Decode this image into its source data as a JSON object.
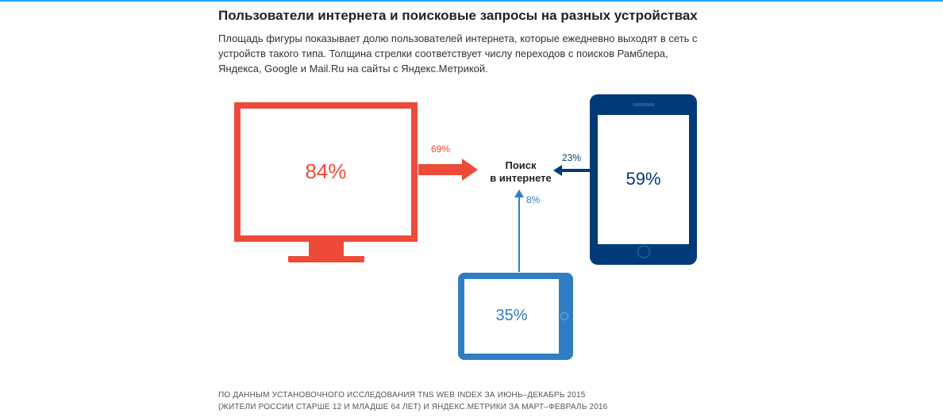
{
  "title": "Пользователи интернета и поисковые запросы на разных устройствах",
  "description": "Площадь фигуры показывает долю пользователей интернета, которые ежедневно выходят в сеть с устройств такого типа. Толщина стрелки соответствует числу переходов с поисков Рамблера, Яндекса, Google и Mail.Ru на сайты с Яндекс.Метрикой.",
  "center": {
    "line1": "Поиск",
    "line2": "в интернете"
  },
  "devices": {
    "desktop": {
      "share": "84%",
      "arrow": "69%",
      "color": "#ee4a3a"
    },
    "phone": {
      "share": "59%",
      "arrow": "23%",
      "color": "#003a77"
    },
    "tablet": {
      "share": "35%",
      "arrow": "8%",
      "color": "#2f7ec3"
    }
  },
  "footnote": {
    "line1": "ПО ДАННЫМ УСТАНОВОЧНОГО ИССЛЕДОВАНИЯ TNS WEB INDEX ЗА ИЮНЬ–ДЕКАБРЬ 2015",
    "line2": "(ЖИТЕЛИ РОССИИ СТАРШЕ 12 И МЛАДШЕ 64 ЛЕТ) И ЯНДЕКС.МЕТРИКИ ЗА МАРТ–ФЕВРАЛЬ 2016"
  },
  "chart_data": {
    "type": "diagram",
    "title": "Пользователи интернета и поисковые запросы на разных устройствах",
    "center_node": "Поиск в интернете",
    "nodes": [
      {
        "device": "desktop",
        "daily_users_share_pct": 84,
        "search_traffic_share_pct": 69,
        "color": "#ee4a3a"
      },
      {
        "device": "smartphone",
        "daily_users_share_pct": 59,
        "search_traffic_share_pct": 23,
        "color": "#003a77"
      },
      {
        "device": "tablet",
        "daily_users_share_pct": 35,
        "search_traffic_share_pct": 8,
        "color": "#2f7ec3"
      }
    ],
    "note": "Area of each device icon ≈ share of daily internet users on that device type; arrow thickness ≈ share of search-engine referral traffic (Rambler, Yandex, Google, Mail.Ru) to sites with Yandex.Metrica."
  }
}
